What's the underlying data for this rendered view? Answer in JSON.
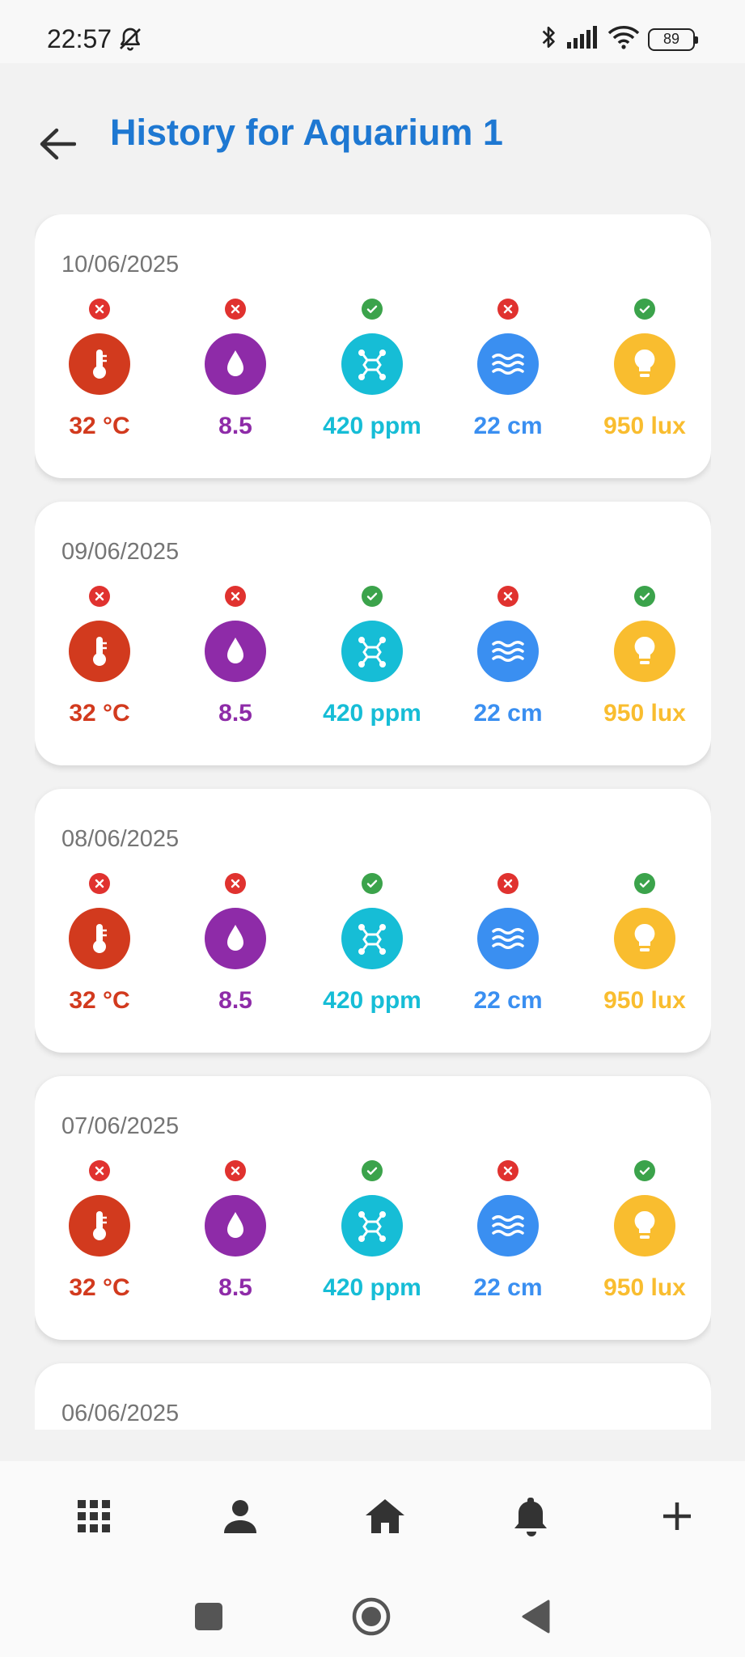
{
  "status_bar": {
    "time": "22:57",
    "battery": "89"
  },
  "header": {
    "title": "History for Aquarium 1"
  },
  "metric_colors": {
    "temperature": "#d23a1e",
    "ph": "#8e2ba8",
    "tds": "#16bdd6",
    "water_level": "#3a8ff1",
    "light": "#f9bd2f"
  },
  "history": [
    {
      "date": "10/06/2025",
      "temperature": "32 °C",
      "ph": "8.5",
      "tds": "420 ppm",
      "water_level": "22 cm",
      "light": "950 lux",
      "status": {
        "temperature": "bad",
        "ph": "bad",
        "tds": "ok",
        "water_level": "bad",
        "light": "ok"
      }
    },
    {
      "date": "09/06/2025",
      "temperature": "32 °C",
      "ph": "8.5",
      "tds": "420 ppm",
      "water_level": "22 cm",
      "light": "950 lux",
      "status": {
        "temperature": "bad",
        "ph": "bad",
        "tds": "ok",
        "water_level": "bad",
        "light": "ok"
      }
    },
    {
      "date": "08/06/2025",
      "temperature": "32 °C",
      "ph": "8.5",
      "tds": "420 ppm",
      "water_level": "22 cm",
      "light": "950 lux",
      "status": {
        "temperature": "bad",
        "ph": "bad",
        "tds": "ok",
        "water_level": "bad",
        "light": "ok"
      }
    },
    {
      "date": "07/06/2025",
      "temperature": "32 °C",
      "ph": "8.5",
      "tds": "420 ppm",
      "water_level": "22 cm",
      "light": "950 lux",
      "status": {
        "temperature": "bad",
        "ph": "bad",
        "tds": "ok",
        "water_level": "bad",
        "light": "ok"
      }
    },
    {
      "date": "06/06/2025"
    }
  ],
  "bottom_nav": [
    "grid-icon",
    "person-icon",
    "home-icon",
    "bell-icon",
    "plus-icon"
  ],
  "system_nav": [
    "recents-icon",
    "home-circle-icon",
    "back-triangle-icon"
  ]
}
